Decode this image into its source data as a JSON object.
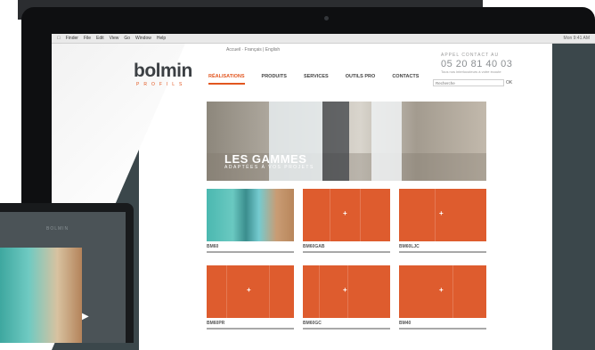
{
  "menubar": {
    "items": [
      "Finder",
      "File",
      "Edit",
      "View",
      "Go",
      "Window",
      "Help"
    ],
    "system": "Mon 9:41 AM"
  },
  "brand": {
    "name": "bolmin",
    "tagline": "PROFILS",
    "accent_color": "#e2561f"
  },
  "lang": "Accueil  ·  Français | English",
  "contact": {
    "label": "APPEL CONTACT AU",
    "phone": "05 20 81 40 03",
    "sub": "Tous nos interlocuteurs à votre écoute"
  },
  "nav": [
    "RÉALISATIONS",
    "PRODUITS",
    "SERVICES",
    "OUTILS PRO",
    "CONTACTS"
  ],
  "search": {
    "placeholder": "Recherche",
    "button": "OK"
  },
  "hero": {
    "title": "LES GAMMES",
    "subtitle": "ADAPTÉES À VOS PROJETS"
  },
  "products": [
    "BM60",
    "BM60GAB",
    "BM60LJC",
    "BM60PR",
    "BM60GC",
    "BM40"
  ],
  "tablet": {
    "header": "BOLMIN"
  }
}
